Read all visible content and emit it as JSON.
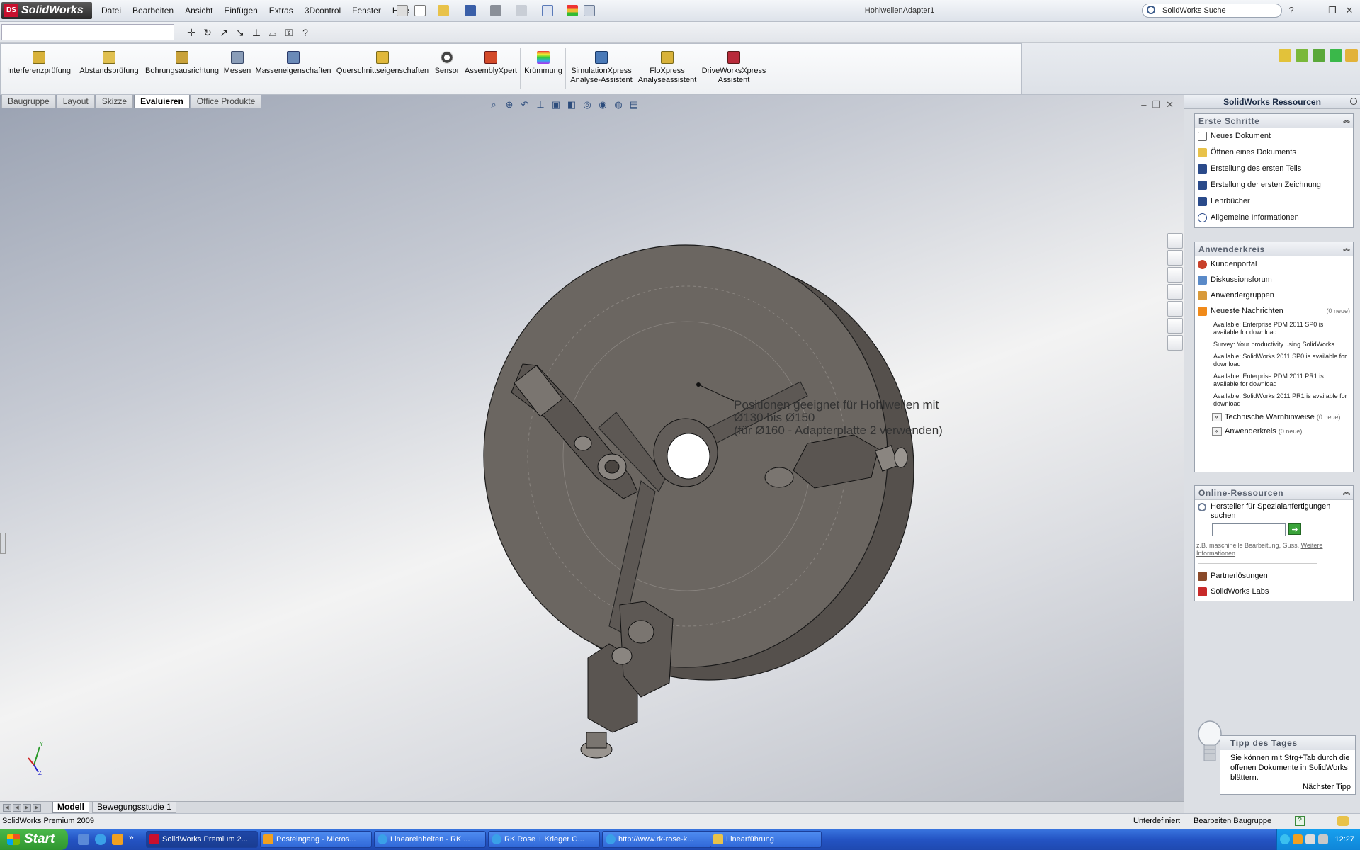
{
  "app": {
    "logo_text": "SolidWorks",
    "document_title": "HohlwellenAdapter1",
    "search_placeholder": "SolidWorks Suche"
  },
  "menu": [
    "Datei",
    "Bearbeiten",
    "Ansicht",
    "Einfügen",
    "Extras",
    "3Dcontrol",
    "Fenster",
    "Hilfe"
  ],
  "command_manager": [
    {
      "label": "Interferenzprüfung",
      "icon": "interference-icon"
    },
    {
      "label": "Abstandsprüfung",
      "icon": "clearance-icon"
    },
    {
      "label": "Bohrungsausrichtung",
      "icon": "hole-alignment-icon"
    },
    {
      "label": "Messen",
      "icon": "measure-icon"
    },
    {
      "label": "Masseneigenschaften",
      "icon": "mass-properties-icon"
    },
    {
      "label": "Querschnittseigenschaften",
      "icon": "section-properties-icon"
    },
    {
      "label": "Sensor",
      "icon": "sensor-icon"
    },
    {
      "label": "AssemblyXpert",
      "icon": "assemblyxpert-icon"
    },
    {
      "label": "Krümmung",
      "icon": "curvature-icon"
    },
    {
      "label": "SimulationXpress\nAnalyse-Assistent",
      "icon": "simulationxpress-icon"
    },
    {
      "label": "FloXpress\nAnalyseassistent",
      "icon": "floxpress-icon"
    },
    {
      "label": "DriveWorksXpress\nAssistent",
      "icon": "driveworksxpress-icon"
    }
  ],
  "tabs": [
    {
      "label": "Baugruppe",
      "active": false
    },
    {
      "label": "Layout",
      "active": false
    },
    {
      "label": "Skizze",
      "active": false
    },
    {
      "label": "Evaluieren",
      "active": true
    },
    {
      "label": "Office Produkte",
      "active": false
    }
  ],
  "viewport": {
    "annotation": "Positionen geeignet für Hohlwellen mit\nØ130 bis Ø150\n(für Ø160 - Adapterplatte 2 verwenden)"
  },
  "bottom_tabs": {
    "model": "Modell",
    "motion": "Bewegungsstudie 1"
  },
  "status": {
    "left": "SolidWorks Premium 2009",
    "state": "Unterdefiniert",
    "mode": "Bearbeiten Baugruppe"
  },
  "task_pane": {
    "title": "SolidWorks Ressourcen",
    "erste_schritte": {
      "title": "Erste Schritte",
      "items": [
        {
          "label": "Neues Dokument",
          "icon": "new-document-icon"
        },
        {
          "label": "Öffnen eines Dokuments",
          "icon": "open-folder-icon"
        },
        {
          "label": "Erstellung des ersten Teils",
          "icon": "graduation-cap-icon"
        },
        {
          "label": "Erstellung der ersten Zeichnung",
          "icon": "graduation-cap-icon"
        },
        {
          "label": "Lehrbücher",
          "icon": "graduation-cap-icon"
        },
        {
          "label": "Allgemeine Informationen",
          "icon": "info-icon"
        }
      ]
    },
    "anwenderkreis": {
      "title": "Anwenderkreis",
      "items": [
        {
          "label": "Kundenportal",
          "icon": "portal-icon"
        },
        {
          "label": "Diskussionsforum",
          "icon": "forum-icon"
        },
        {
          "label": "Anwendergruppen",
          "icon": "user-groups-icon"
        },
        {
          "label": "Neueste Nachrichten",
          "icon": "rss-icon",
          "count": "(0 neue)"
        }
      ],
      "news": [
        "Available: Enterprise PDM 2011 SP0 is available for download",
        "Survey: Your productivity using SolidWorks",
        "Available: SolidWorks 2011 SP0 is available for download",
        "Available: Enterprise PDM 2011 PR1 is available for download",
        "Available: SolidWorks 2011 PR1 is available for download"
      ],
      "technische": {
        "label": "Technische Warnhinweise",
        "count": "(0 neue)"
      },
      "kreis": {
        "label": "Anwenderkreis",
        "count": "(0 neue)"
      }
    },
    "online": {
      "title": "Online-Ressourcen",
      "search_label": "Hersteller für Spezialanfertigungen suchen",
      "hint": "z.B. maschinelle Bearbeitung, Guss.",
      "hint_link": "Weitere Informationen",
      "items": [
        {
          "label": "Partnerlösungen",
          "icon": "partner-icon"
        },
        {
          "label": "SolidWorks Labs",
          "icon": "labs-icon"
        }
      ]
    },
    "tip": {
      "title": "Tipp des Tages",
      "text": "Sie können mit Strg+Tab durch die offenen Dokumente in SolidWorks blättern.",
      "next": "Nächster Tipp"
    }
  },
  "taskbar": {
    "start": "Start",
    "tasks": [
      {
        "label": "SolidWorks Premium 2...",
        "active": true
      },
      {
        "label": "Posteingang - Micros...",
        "active": false
      },
      {
        "label": "Lineareinheiten - RK ...",
        "active": false
      },
      {
        "label": "RK Rose + Krieger G...",
        "active": false
      },
      {
        "label": "http://www.rk-rose-k...",
        "active": false
      },
      {
        "label": "Linearführung",
        "active": false
      }
    ],
    "clock": "12:27"
  },
  "colors": {
    "accent": "#2454c4",
    "start_green": "#3aa33a",
    "model_gray": "#6b6661"
  }
}
